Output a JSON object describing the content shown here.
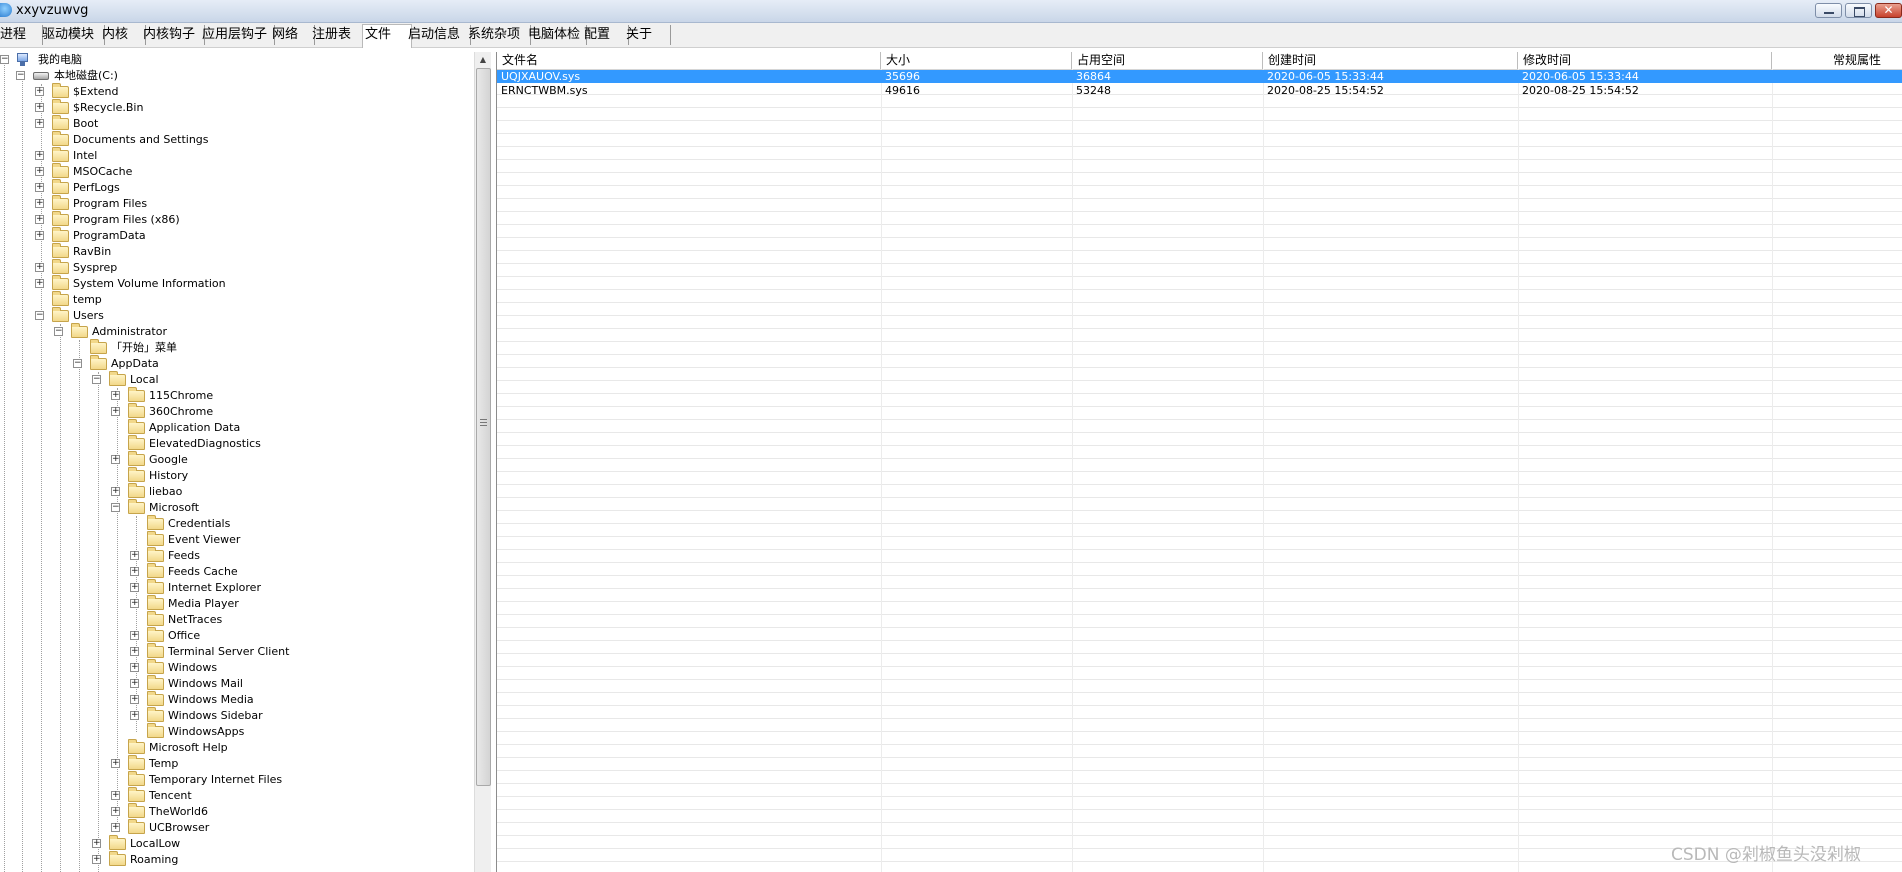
{
  "window": {
    "title": "xxyvzuwvg"
  },
  "tabs": [
    {
      "label": "进程"
    },
    {
      "label": "驱动模块"
    },
    {
      "label": "内核"
    },
    {
      "label": "内核钩子"
    },
    {
      "label": "应用层钩子"
    },
    {
      "label": "网络"
    },
    {
      "label": "注册表"
    },
    {
      "label": "文件"
    },
    {
      "label": "启动信息"
    },
    {
      "label": "系统杂项"
    },
    {
      "label": "电脑体检"
    },
    {
      "label": "配置"
    },
    {
      "label": "关于"
    }
  ],
  "active_tab": "文件",
  "tree": {
    "root": "我的电脑",
    "drive": "本地磁盘(C:)",
    "c_items": [
      {
        "label": "$Extend",
        "expandable": true
      },
      {
        "label": "$Recycle.Bin",
        "expandable": true
      },
      {
        "label": "Boot",
        "expandable": true
      },
      {
        "label": "Documents and Settings",
        "expandable": false
      },
      {
        "label": "Intel",
        "expandable": true
      },
      {
        "label": "MSOCache",
        "expandable": true
      },
      {
        "label": "PerfLogs",
        "expandable": true
      },
      {
        "label": "Program Files",
        "expandable": true
      },
      {
        "label": "Program Files (x86)",
        "expandable": true
      },
      {
        "label": "ProgramData",
        "expandable": true
      },
      {
        "label": "RavBin",
        "expandable": false
      },
      {
        "label": "Sysprep",
        "expandable": true
      },
      {
        "label": "System Volume Information",
        "expandable": true
      },
      {
        "label": "temp",
        "expandable": false
      },
      {
        "label": "Users",
        "expandable": true,
        "expanded": true
      }
    ],
    "administrator": "Administrator",
    "start_menu": "「开始」菜单",
    "appdata": "AppData",
    "local": "Local",
    "local_items_before_ms": [
      {
        "label": "115Chrome",
        "expandable": true
      },
      {
        "label": "360Chrome",
        "expandable": true
      },
      {
        "label": "Application Data",
        "expandable": false
      },
      {
        "label": "ElevatedDiagnostics",
        "expandable": false
      },
      {
        "label": "Google",
        "expandable": true
      },
      {
        "label": "History",
        "expandable": false
      },
      {
        "label": "liebao",
        "expandable": true
      }
    ],
    "microsoft": "Microsoft",
    "microsoft_items": [
      {
        "label": "Credentials",
        "expandable": false
      },
      {
        "label": "Event Viewer",
        "expandable": false
      },
      {
        "label": "Feeds",
        "expandable": true
      },
      {
        "label": "Feeds Cache",
        "expandable": true
      },
      {
        "label": "Internet Explorer",
        "expandable": true
      },
      {
        "label": "Media Player",
        "expandable": true
      },
      {
        "label": "NetTraces",
        "expandable": false
      },
      {
        "label": "Office",
        "expandable": true
      },
      {
        "label": "Terminal Server Client",
        "expandable": true
      },
      {
        "label": "Windows",
        "expandable": true
      },
      {
        "label": "Windows Mail",
        "expandable": true
      },
      {
        "label": "Windows Media",
        "expandable": true
      },
      {
        "label": "Windows Sidebar",
        "expandable": true
      },
      {
        "label": "WindowsApps",
        "expandable": false
      }
    ],
    "local_items_after_ms": [
      {
        "label": "Microsoft Help",
        "expandable": false
      },
      {
        "label": "Temp",
        "expandable": true
      },
      {
        "label": "Temporary Internet Files",
        "expandable": false
      },
      {
        "label": "Tencent",
        "expandable": true
      },
      {
        "label": "TheWorld6",
        "expandable": true
      },
      {
        "label": "UCBrowser",
        "expandable": true
      }
    ],
    "appdata_items_after_local": [
      {
        "label": "LocalLow",
        "expandable": true
      },
      {
        "label": "Roaming",
        "expandable": true
      }
    ]
  },
  "file_list": {
    "columns": [
      "文件名",
      "大小",
      "占用空间",
      "创建时间",
      "修改时间",
      "常规属性"
    ],
    "rows": [
      {
        "name": "UQJXAUOV.sys",
        "size": "35696",
        "alloc": "36864",
        "created": "2020-06-05 15:33:44",
        "modified": "2020-06-05 15:33:44",
        "attr": "",
        "selected": true
      },
      {
        "name": "ERNCTWBM.sys",
        "size": "49616",
        "alloc": "53248",
        "created": "2020-08-25 15:54:52",
        "modified": "2020-08-25 15:54:52",
        "attr": "",
        "selected": false
      }
    ]
  },
  "watermark": "CSDN @剁椒鱼头没剁椒",
  "colors": {
    "selection": "#3399ff",
    "title_gradient_top": "#e6edf7",
    "close_button": "#c7412c"
  }
}
